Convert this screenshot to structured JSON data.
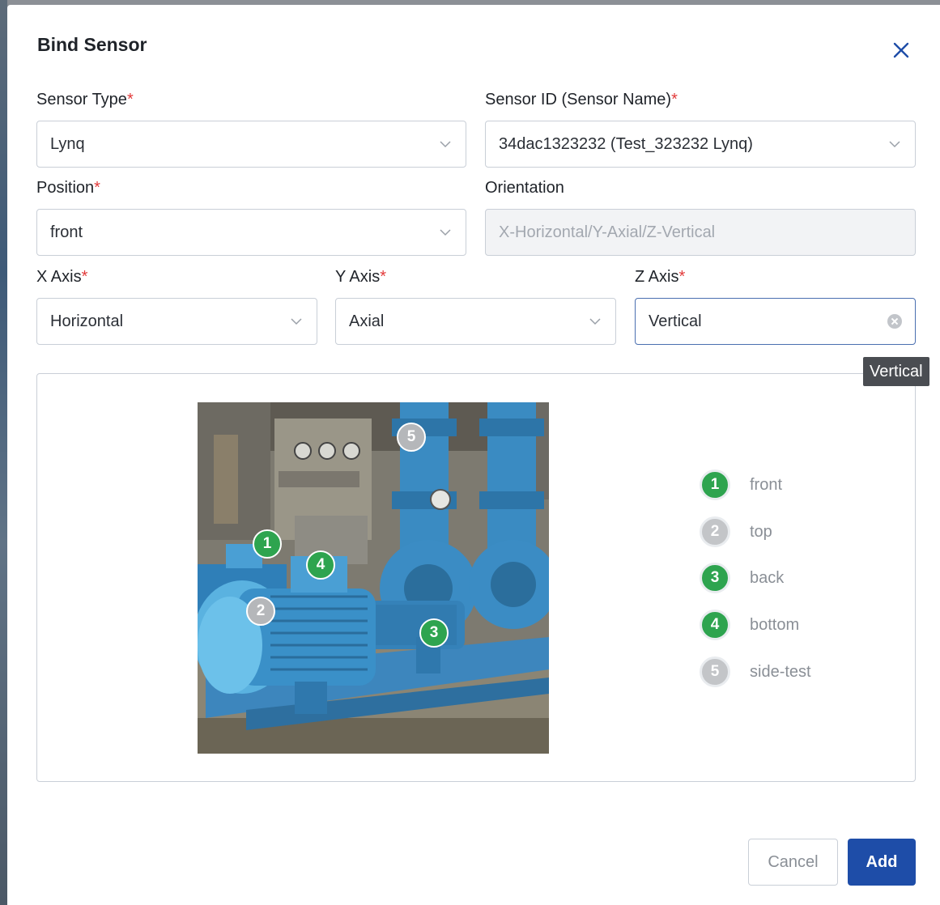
{
  "modal": {
    "title": "Bind Sensor"
  },
  "fields": {
    "sensor_type": {
      "label": "Sensor Type",
      "required": "*",
      "value": "Lynq"
    },
    "sensor_id": {
      "label": "Sensor ID (Sensor Name)",
      "required": "*",
      "value": "34dac1323232 (Test_323232 Lynq)"
    },
    "position": {
      "label": "Position",
      "required": "*",
      "value": "front"
    },
    "orientation": {
      "label": "Orientation",
      "placeholder": "X-Horizontal/Y-Axial/Z-Vertical"
    },
    "x_axis": {
      "label": "X Axis",
      "required": "*",
      "value": "Horizontal"
    },
    "y_axis": {
      "label": "Y Axis",
      "required": "*",
      "value": "Axial"
    },
    "z_axis": {
      "label": "Z Axis",
      "required": "*",
      "value": "Vertical"
    }
  },
  "tooltip": {
    "text": "Vertical"
  },
  "markers": [
    {
      "num": "1",
      "active": true
    },
    {
      "num": "2",
      "active": false
    },
    {
      "num": "3",
      "active": true
    },
    {
      "num": "4",
      "active": true
    },
    {
      "num": "5",
      "active": false
    }
  ],
  "legend": [
    {
      "num": "1",
      "label": "front",
      "active": true
    },
    {
      "num": "2",
      "label": "top",
      "active": false
    },
    {
      "num": "3",
      "label": "back",
      "active": true
    },
    {
      "num": "4",
      "label": "bottom",
      "active": true
    },
    {
      "num": "5",
      "label": "side-test",
      "active": false
    }
  ],
  "buttons": {
    "cancel": "Cancel",
    "add": "Add"
  },
  "colors": {
    "active_marker": "#2ea44f",
    "inactive_marker": "#b5b7ba",
    "primary": "#1e4da8",
    "required": "#e23a3a"
  },
  "icons": {
    "close": "close-icon",
    "dropdown": "chevron-down-icon",
    "clear": "clear-circle-icon"
  }
}
